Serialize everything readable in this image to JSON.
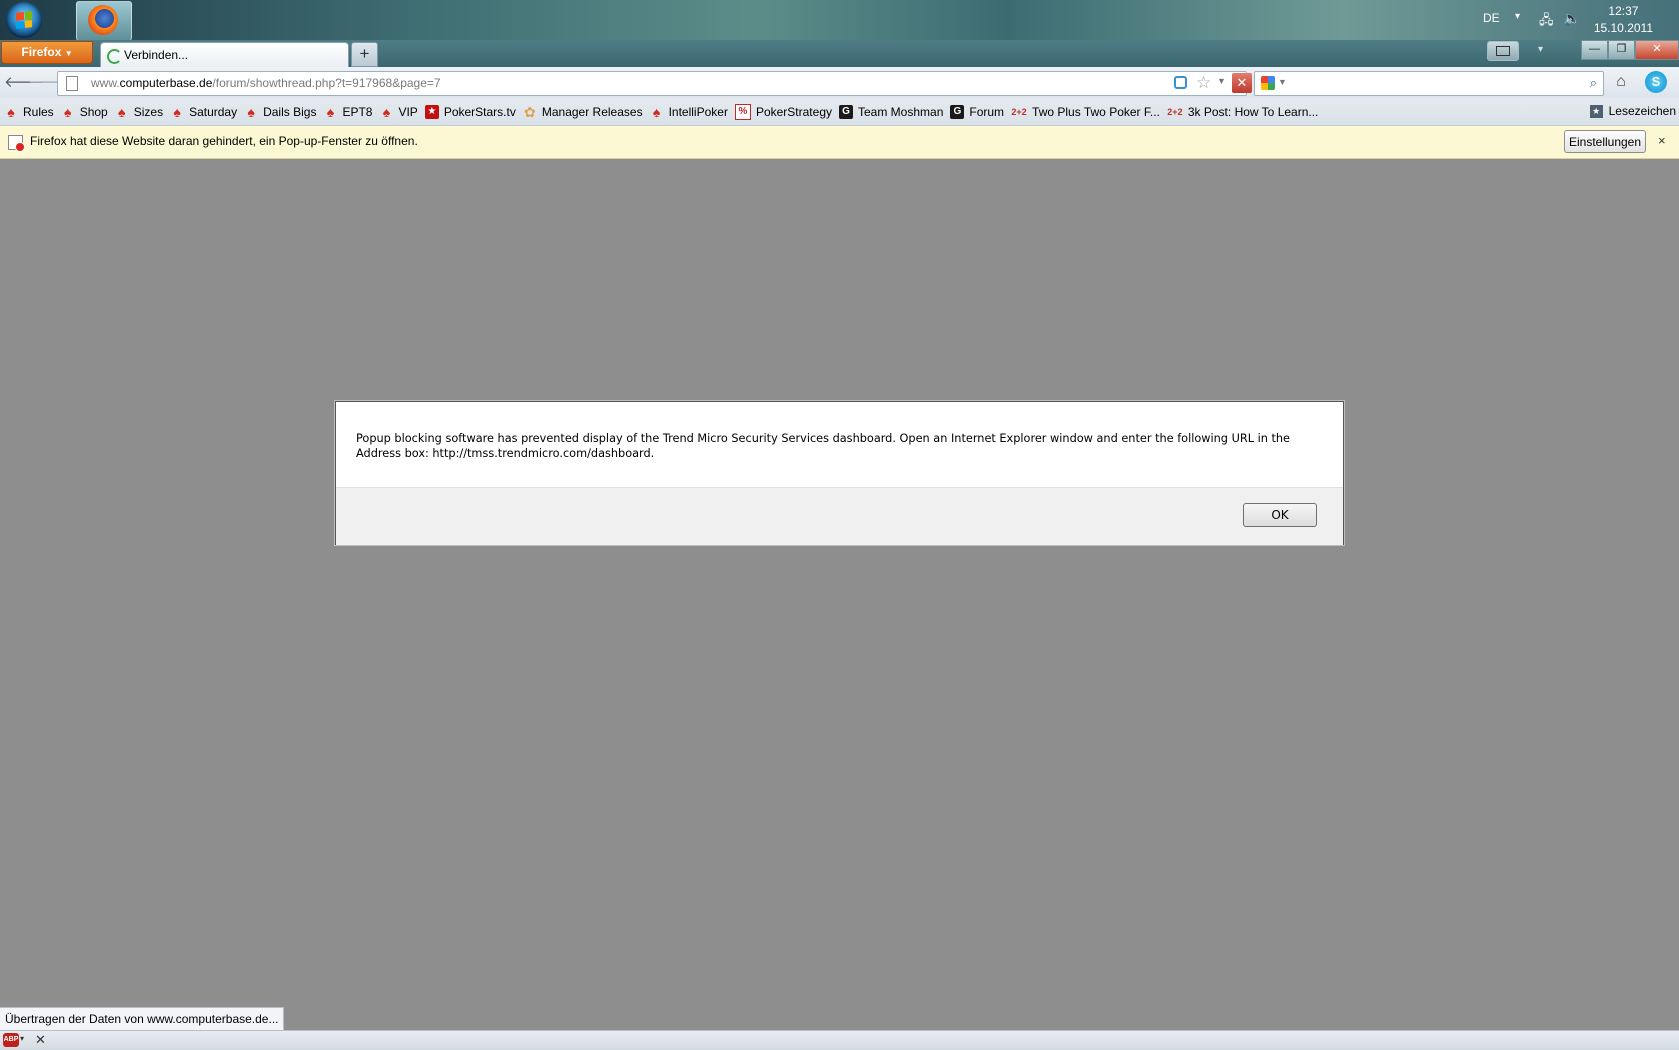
{
  "taskbar": {
    "language": "DE",
    "time": "12:37",
    "date": "15.10.2011"
  },
  "firefox_menu": {
    "label": "Firefox"
  },
  "tabs": [
    {
      "title": "Verbinden...",
      "loading": true
    }
  ],
  "new_tab": {
    "label": "+"
  },
  "navigation": {
    "url_domain_prefix": "www.",
    "url_domain": "computerbase.de",
    "url_path": "/forum/showthread.php?t=917968&page=7"
  },
  "bookmarks": [
    {
      "label": "Rules",
      "icon": "pokerstars-spade-icon"
    },
    {
      "label": "Shop",
      "icon": "pokerstars-spade-icon"
    },
    {
      "label": "Sizes",
      "icon": "pokerstars-spade-icon"
    },
    {
      "label": "Saturday",
      "icon": "pokerstars-spade-icon"
    },
    {
      "label": "Dails Bigs",
      "icon": "pokerstars-spade-icon"
    },
    {
      "label": "EPT8",
      "icon": "pokerstars-spade-icon"
    },
    {
      "label": "VIP",
      "icon": "pokerstars-spade-icon"
    },
    {
      "label": "PokerStars.tv",
      "icon": "pokerstars-tv-icon"
    },
    {
      "label": "Manager Releases",
      "icon": "gear-icon"
    },
    {
      "label": "IntelliPoker",
      "icon": "pokerstars-spade-icon"
    },
    {
      "label": "PokerStrategy",
      "icon": "pokerstrategy-icon"
    },
    {
      "label": "Team Moshman",
      "icon": "g-icon"
    },
    {
      "label": "Forum",
      "icon": "g-icon"
    },
    {
      "label": "Two Plus Two Poker F...",
      "icon": "twoplustwo-icon"
    },
    {
      "label": "3k Post: How To Learn...",
      "icon": "twoplustwo-icon"
    }
  ],
  "bookmarks_menu": {
    "label": "Lesezeichen"
  },
  "popup_notification": {
    "message": "Firefox hat diese Website daran gehindert, ein Pop-up-Fenster zu öffnen.",
    "settings_label": "Einstellungen",
    "close_label": "×"
  },
  "dialog": {
    "message": "Popup blocking software has prevented display of the Trend Micro Security Services dashboard. Open an Internet Explorer window and enter the following URL in the Address box: http://tmss.trendmicro.com/dashboard.",
    "ok_label": "OK"
  },
  "status": {
    "text": "Übertragen der Daten von www.computerbase.de...",
    "abp_label": "ABP"
  },
  "colors": {
    "page_background": "#8e8e8e",
    "notification_background": "#fcf8d3",
    "firefox_orange": "#e07b27"
  }
}
